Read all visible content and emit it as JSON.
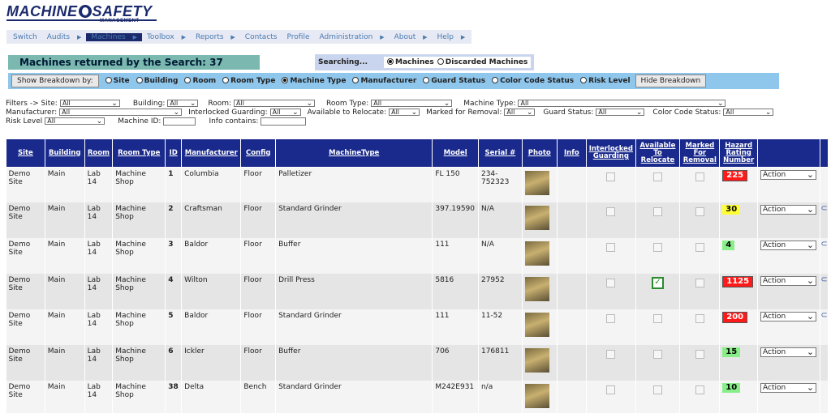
{
  "logo": {
    "line1a": "MACHINE",
    "line1b": "SAFETY",
    "line2": "MANAGEMENT"
  },
  "nav": [
    {
      "label": "Switch",
      "arrow": false,
      "active": false
    },
    {
      "label": "Audits",
      "arrow": true,
      "active": false
    },
    {
      "label": "Machines",
      "arrow": true,
      "active": true
    },
    {
      "label": "Toolbox",
      "arrow": true,
      "active": false
    },
    {
      "label": "Reports",
      "arrow": true,
      "active": false
    },
    {
      "label": "Contacts",
      "arrow": false,
      "active": false
    },
    {
      "label": "Profile",
      "arrow": false,
      "active": false
    },
    {
      "label": "Administration",
      "arrow": true,
      "active": false
    },
    {
      "label": "About",
      "arrow": true,
      "active": false
    },
    {
      "label": "Help",
      "arrow": true,
      "active": false
    }
  ],
  "results_title": "Machines returned by the Search: 37",
  "searching": {
    "label": "Searching...",
    "opt_machines": "Machines",
    "opt_discarded": "Discarded Machines"
  },
  "breakdown": {
    "show_button": "Show Breakdown by:",
    "hide_button": "Hide Breakdown",
    "options": [
      "Site",
      "Building",
      "Room",
      "Room Type",
      "Machine Type",
      "Manufacturer",
      "Guard Status",
      "Color Code Status",
      "Risk Level"
    ],
    "selected": "Machine Type"
  },
  "filters": {
    "prefix": "Filters -> Site:",
    "site": "All",
    "building_label": "Building:",
    "building": "All",
    "room_label": "Room:",
    "room": "All",
    "room_type_label": "Room Type:",
    "room_type": "All",
    "machine_type_label": "Machine Type:",
    "machine_type": "All",
    "manufacturer_label": "Manufacturer:",
    "manufacturer": "All",
    "interlocked_label": "Interlocked Guarding:",
    "interlocked": "All",
    "relocate_label": "Available to Relocate:",
    "relocate": "All",
    "removal_label": "Marked for Removal:",
    "removal": "All",
    "guard_label": "Guard Status:",
    "guard": "All",
    "color_label": "Color Code Status:",
    "color": "All",
    "risk_label": "Risk Level",
    "risk": "All",
    "machine_id_label": "Machine ID:",
    "info_label": "Info contains:"
  },
  "columns": [
    "Site",
    "Building",
    "Room",
    "Room Type",
    "ID",
    "Manufacturer",
    "Config",
    "MachineType",
    "Model",
    "Serial #",
    "Photo",
    "Info",
    "Interlocked Guarding",
    "Available To Relocate",
    "Marked For Removal",
    "Hazard Rating Number"
  ],
  "colors": {
    "header_bg": "#1a2a8c",
    "accent": "#1a2a6c"
  },
  "rows": [
    {
      "site": "Demo Site",
      "building": "Main",
      "room": "Lab 14",
      "room_type": "Machine Shop",
      "id": "1",
      "manufacturer": "Columbia",
      "config": "Floor",
      "machine_type": "Palletizer",
      "model": "FL 150",
      "serial": "234-752323",
      "relocate": false,
      "hazard": "225",
      "hazard_color": "red",
      "action": "Action",
      "clip": false
    },
    {
      "site": "Demo Site",
      "building": "Main",
      "room": "Lab 14",
      "room_type": "Machine Shop",
      "id": "2",
      "manufacturer": "Craftsman",
      "config": "Floor",
      "machine_type": "Standard Grinder",
      "model": "397.19590",
      "serial": "N/A",
      "relocate": false,
      "hazard": "30",
      "hazard_color": "yellow",
      "action": "Action",
      "clip": true
    },
    {
      "site": "Demo Site",
      "building": "Main",
      "room": "Lab 14",
      "room_type": "Machine Shop",
      "id": "3",
      "manufacturer": "Baldor",
      "config": "Floor",
      "machine_type": "Buffer",
      "model": "111",
      "serial": "N/A",
      "relocate": false,
      "hazard": "4",
      "hazard_color": "green",
      "action": "Action",
      "clip": true
    },
    {
      "site": "Demo Site",
      "building": "Main",
      "room": "Lab 14",
      "room_type": "Machine Shop",
      "id": "4",
      "manufacturer": "Wilton",
      "config": "Floor",
      "machine_type": "Drill Press",
      "model": "5816",
      "serial": "27952",
      "relocate": true,
      "hazard": "1125",
      "hazard_color": "red",
      "action": "Action",
      "clip": true
    },
    {
      "site": "Demo Site",
      "building": "Main",
      "room": "Lab 14",
      "room_type": "Machine Shop",
      "id": "5",
      "manufacturer": "Baldor",
      "config": "Floor",
      "machine_type": "Standard Grinder",
      "model": "111",
      "serial": "11-52",
      "relocate": false,
      "hazard": "200",
      "hazard_color": "red",
      "action": "Action",
      "clip": true
    },
    {
      "site": "Demo Site",
      "building": "Main",
      "room": "Lab 14",
      "room_type": "Machine Shop",
      "id": "6",
      "manufacturer": "Ickler",
      "config": "Floor",
      "machine_type": "Buffer",
      "model": "706",
      "serial": "176811",
      "relocate": false,
      "hazard": "15",
      "hazard_color": "green",
      "action": "Action",
      "clip": false
    },
    {
      "site": "Demo Site",
      "building": "Main",
      "room": "Lab 14",
      "room_type": "Machine Shop",
      "id": "38",
      "manufacturer": "Delta",
      "config": "Bench",
      "machine_type": "Standard Grinder",
      "model": "M242E931",
      "serial": "n/a",
      "relocate": false,
      "hazard": "10",
      "hazard_color": "green",
      "action": "Action",
      "clip": false
    }
  ]
}
